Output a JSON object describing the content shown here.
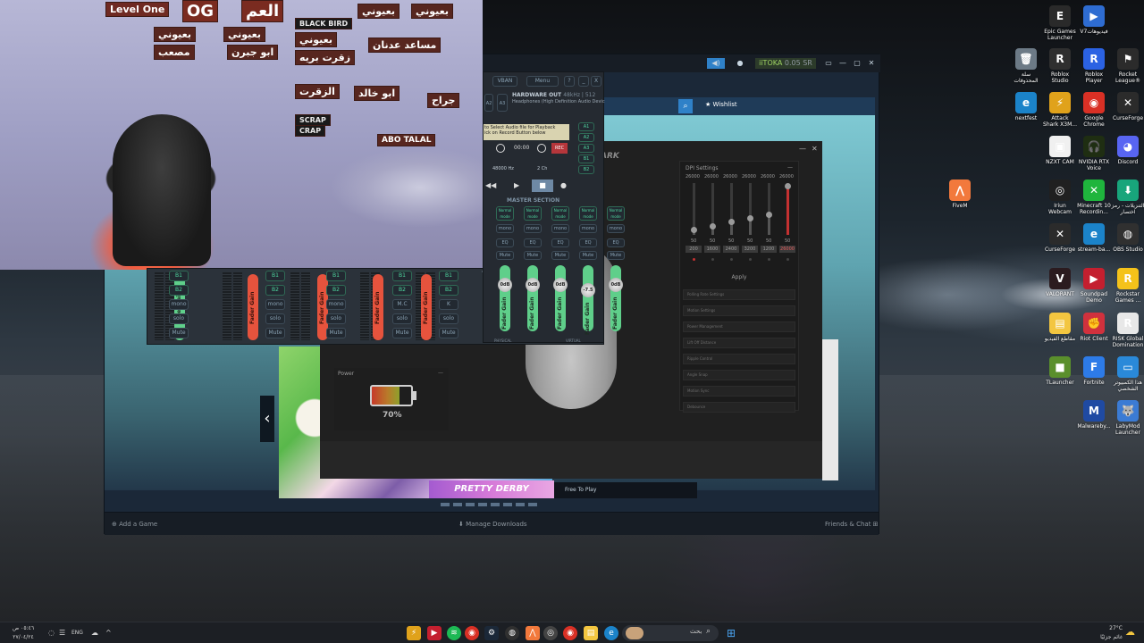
{
  "steam": {
    "wishlist": "Wishlist",
    "user_badge": "iiTOKA",
    "user_balance": "0.05 SR",
    "free_to_play": "Free To Play",
    "add_game": "Add a Game",
    "manage_downloads": "Manage Downloads",
    "friends_chat": "Friends & Chat",
    "banner_text": "PRETTY DERBY",
    "prev_arrow": "‹"
  },
  "ghub": {
    "brand_fragment": "ARK",
    "dpi_title": "DPI Settings",
    "dpi_values": [
      "26000",
      "26000",
      "26000",
      "26000",
      "26000",
      "26000"
    ],
    "dpi_levels": [
      0.1,
      0.18,
      0.25,
      0.32,
      0.4,
      0.95
    ],
    "dpi_scale_bottom": [
      "50",
      "50",
      "50",
      "50",
      "50",
      "50"
    ],
    "dpi_steps": [
      "200",
      "1600",
      "2400",
      "3200",
      "1200",
      "26000"
    ],
    "apply": "Apply",
    "options": [
      "Polling Rate Settings",
      "Motion Settings",
      "Power Management",
      "Lift Off Distance",
      "Ripple Control",
      "Angle Snap",
      "Motion Sync",
      "Debounce"
    ],
    "power_title": "Power",
    "battery_percent": "70%",
    "battery_level": 0.7
  },
  "voicemeeter": {
    "vban": "VBAN",
    "menu": "Menu",
    "help": "?",
    "minimize": "_",
    "close": "X",
    "a2": "A2",
    "a3": "A3",
    "hw_out_title": "HARDWARE OUT",
    "hw_out_rate": "48kHz | 512",
    "hw_out_device": "Headphones (High Definition Audio Devic",
    "tape_line1": "to Select Audio file for Playback",
    "tape_line2": "ick on Record Button below",
    "tape_time": "00:00",
    "tape_rec": "REC",
    "sample_rate": "48000 Hz",
    "channels": "2 Ch",
    "bus_buttons": [
      "A1",
      "A2",
      "A3",
      "B1",
      "B2"
    ],
    "master_section": "MASTER SECTION",
    "master_modes": [
      "Normal mode",
      "Normal mode",
      "Normal mode",
      "Normal mode",
      "Normal mode"
    ],
    "master_mono": "mono",
    "master_eq": "EQ",
    "master_mute": "Mute",
    "master_gains": [
      "0dB",
      "0dB",
      "0dB",
      "-7.5",
      "0dB"
    ],
    "fader_gain": "Fader Gain",
    "physical": "PHYSICAL",
    "virtual": "VIRTUAL",
    "strip_buttons": [
      "B1",
      "B2",
      "mono",
      "solo",
      "Mute"
    ],
    "strip_mc": "M.C",
    "strip_k": "K",
    "bus_labels": [
      "A1",
      "A2",
      "A3",
      "B1",
      "B2"
    ]
  },
  "webcam": {
    "sign_level": "Level One",
    "sign_og": "OG",
    "sign_og_arabic": "العم",
    "sign_blackbird": "BLACK BIRD",
    "sign_scrap": "SCRAP",
    "sign_crap": "CRAP",
    "sign_abotalal": "ABO TALAL",
    "sticker_1": "بعيوني",
    "sticker_2": "مصعب",
    "sticker_3": "ابو جبرن",
    "sticker_4": "زقرت بريه",
    "sticker_5": "الزقرت",
    "sticker_6": "مساعد عدنان",
    "sticker_7": "ابو خالد",
    "sticker_8": "جراح"
  },
  "desktop_icons": [
    {
      "label": "Epic Games Launcher",
      "icon": "epic-games-icon",
      "color": "#2a2a2a",
      "glyph": "E"
    },
    {
      "label": "V7فيديوهات",
      "icon": "video-folder-icon",
      "color": "#2e6cd1",
      "glyph": "▶"
    },
    {
      "label": "سلة المحذوفات",
      "icon": "recycle-bin-icon",
      "color": "#6c7a86",
      "glyph": "🗑"
    },
    {
      "label": "Roblox Studio",
      "icon": "roblox-studio-icon",
      "color": "#2f2f2f",
      "glyph": "R"
    },
    {
      "label": "Roblox Player",
      "icon": "roblox-player-icon",
      "color": "#2b62e3",
      "glyph": "R"
    },
    {
      "label": "Rocket League®",
      "icon": "rocket-league-icon",
      "color": "#2b2b2b",
      "glyph": "⚑"
    },
    {
      "label": "nextfest",
      "icon": "edge-icon",
      "color": "#1b83c9",
      "glyph": "e"
    },
    {
      "label": "Attack Shark X3M...",
      "icon": "attack-shark-icon",
      "color": "#e0a21b",
      "glyph": "⚡"
    },
    {
      "label": "Google Chrome",
      "icon": "chrome-icon",
      "color": "#d93025",
      "glyph": "◉"
    },
    {
      "label": "CurseForge",
      "icon": "curseforge-icon",
      "color": "#2b2b2b",
      "glyph": "✕"
    },
    {
      "label": "NZXT CAM",
      "icon": "nzxt-cam-icon",
      "color": "#f0f0f0",
      "glyph": "▣"
    },
    {
      "label": "NVIDIA RTX Voice",
      "icon": "nvidia-voice-icon",
      "color": "#1f2e12",
      "glyph": "🎧"
    },
    {
      "label": "Discord",
      "icon": "discord-icon",
      "color": "#5865f2",
      "glyph": "◕"
    },
    {
      "label": "FiveM",
      "icon": "fivem-icon",
      "color": "#f2793c",
      "glyph": "⋀"
    },
    {
      "label": "Iriun Webcam",
      "icon": "iriun-webcam-icon",
      "color": "#202020",
      "glyph": "◎"
    },
    {
      "label": "Minecraft 10 Recordin...",
      "icon": "minecraft-record-icon",
      "color": "#1fb53d",
      "glyph": "✕"
    },
    {
      "label": "التنزيلات - رمز اختصار",
      "icon": "downloads-shortcut-icon",
      "color": "#18a57b",
      "glyph": "⬇"
    },
    {
      "label": "CurseForge",
      "icon": "curseforge-2-icon",
      "color": "#2b2b2b",
      "glyph": "✕"
    },
    {
      "label": "stream-ba...",
      "icon": "edge-2-icon",
      "color": "#1b83c9",
      "glyph": "e"
    },
    {
      "label": "OBS Studio",
      "icon": "obs-icon",
      "color": "#303030",
      "glyph": "◍"
    },
    {
      "label": "VALORANT",
      "icon": "valorant-icon",
      "color": "#2b1b1f",
      "glyph": "V"
    },
    {
      "label": "Soundpad Demo",
      "icon": "soundpad-icon",
      "color": "#c41f2f",
      "glyph": "▶"
    },
    {
      "label": "Rockstar Games ...",
      "icon": "rockstar-icon",
      "color": "#f4c21a",
      "glyph": "R"
    },
    {
      "label": "مقاطع الفيديو",
      "icon": "videos-folder-icon",
      "color": "#f3c640",
      "glyph": "▤"
    },
    {
      "label": "Riot Client",
      "icon": "riot-client-icon",
      "color": "#d1313d",
      "glyph": "✊"
    },
    {
      "label": "RISK Global Domination",
      "icon": "risk-icon",
      "color": "#e8e8e8",
      "glyph": "R"
    },
    {
      "label": "TLauncher",
      "icon": "tlauncher-icon",
      "color": "#5a8f2c",
      "glyph": "■"
    },
    {
      "label": "Fortnite",
      "icon": "fortnite-icon",
      "color": "#2d7be8",
      "glyph": "F"
    },
    {
      "label": "هذا الكمبيوتر الشخصي",
      "icon": "this-pc-icon",
      "color": "#2a89d9",
      "glyph": "▭"
    },
    {
      "label": "Malwareby...",
      "icon": "malwarebytes-icon",
      "color": "#1f4aa3",
      "glyph": "M"
    },
    {
      "label": "LabyMod Launcher",
      "icon": "labymod-icon",
      "color": "#3b7bd4",
      "glyph": "🐺"
    }
  ],
  "taskbar": {
    "time": "٠٥:٤٦ ص",
    "date": "٢٧/٠٤/٢٤",
    "language": "ENG",
    "search_placeholder": "بحث",
    "weather_temp": "27°C",
    "weather_desc": "غائم جزئيًا",
    "tray_chevron": "^"
  }
}
